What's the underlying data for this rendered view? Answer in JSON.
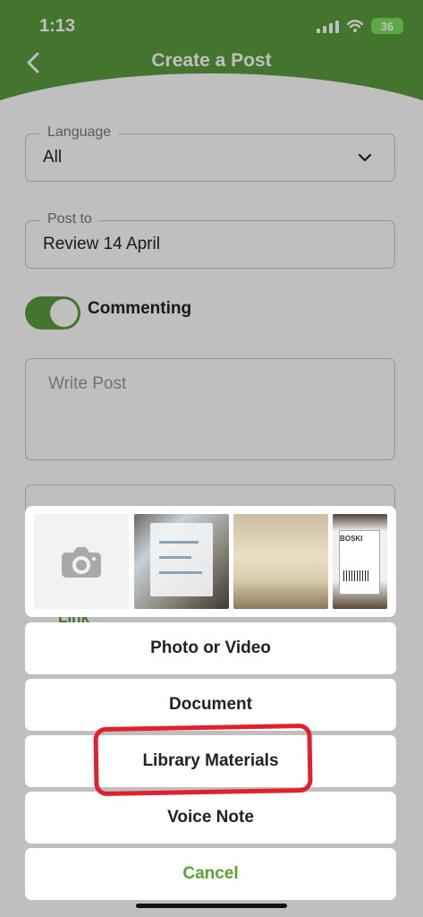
{
  "status_bar": {
    "time": "1:13",
    "battery": "36"
  },
  "header": {
    "title": "Create a Post"
  },
  "form": {
    "language_label": "Language",
    "language_value": "All",
    "post_to_label": "Post to",
    "post_to_value": "Review 14 April",
    "commenting_label": "Commenting",
    "write_post_placeholder": "Write Post",
    "link_label": "Link"
  },
  "picker": {
    "options": [
      "Photo or Video",
      "Document",
      "Library Materials",
      "Voice Note"
    ],
    "cancel": "Cancel",
    "photo_brand": "BOSKI"
  },
  "colors": {
    "brand_green": "#5a9d3f",
    "cancel_green": "#5aa32e",
    "annotation_red": "#e21f2c"
  }
}
